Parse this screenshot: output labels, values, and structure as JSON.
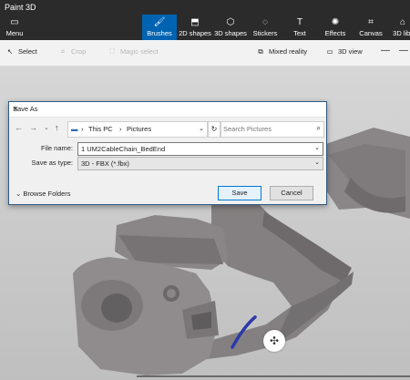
{
  "app": {
    "title": "Paint 3D"
  },
  "ribbon": {
    "menu": "Menu",
    "items": [
      {
        "label": "Brushes",
        "icon": "brush-icon",
        "active": true
      },
      {
        "label": "2D shapes",
        "icon": "2d-shapes-icon"
      },
      {
        "label": "3D shapes",
        "icon": "3d-shapes-icon"
      },
      {
        "label": "Stickers",
        "icon": "stickers-icon"
      },
      {
        "label": "Text",
        "icon": "text-icon"
      },
      {
        "label": "Effects",
        "icon": "effects-icon"
      },
      {
        "label": "Canvas",
        "icon": "canvas-icon"
      },
      {
        "label": "3D libr",
        "icon": "3d-library-icon"
      }
    ]
  },
  "toolbar": {
    "select": "Select",
    "crop": "Crop",
    "magic_select": "Magic select",
    "mixed_reality": "Mixed reality",
    "view_3d": "3D view"
  },
  "dialog": {
    "title": "Save As",
    "breadcrumb": [
      "This PC",
      "Pictures"
    ],
    "search_placeholder": "Search Pictures",
    "file_name_label": "File name:",
    "file_name": "1 UM2CableChain_BedEnd",
    "save_type_label": "Save as type:",
    "save_type": "3D - FBX (*.fbx)",
    "browse_folders": "Browse Folders",
    "save": "Save",
    "cancel": "Cancel"
  },
  "colors": {
    "ribbon_bg": "#2b2b2b",
    "active": "#0063b1",
    "model": "#7b7678",
    "stroke": "#2a3aa8"
  }
}
